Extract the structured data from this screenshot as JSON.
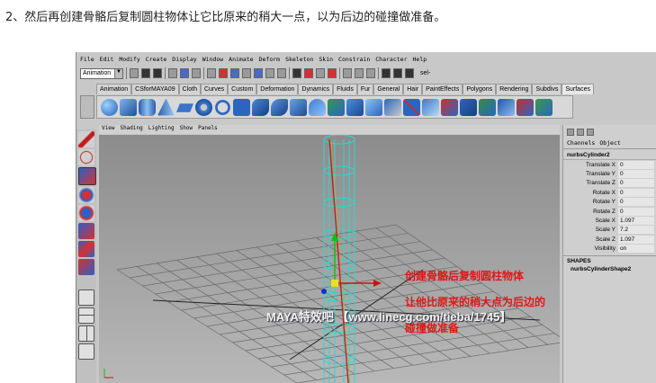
{
  "caption": "2、然后再创建骨骼后复制圆柱物体让它比原来的稍大一点，以为后边的碰撞做准备。",
  "menubar": [
    "File",
    "Edit",
    "Modify",
    "Create",
    "Display",
    "Window",
    "Animate",
    "Deform",
    "Skeleton",
    "Skin",
    "Constrain",
    "Character",
    "Help"
  ],
  "statusline": {
    "mode": "Animation",
    "sel_label": "sel-"
  },
  "shelf_tabs": [
    "Animation",
    "CSforMAYA09",
    "Cloth",
    "Curves",
    "Custom",
    "Deformation",
    "Dynamics",
    "Fluids",
    "Fur",
    "General",
    "Hair",
    "PaintEffects",
    "Polygons",
    "Rendering",
    "Subdivs",
    "Surfaces"
  ],
  "shelf_active": "Surfaces",
  "panel_menu": [
    "View",
    "Shading",
    "Lighting",
    "Show",
    "Panels"
  ],
  "channel_box": {
    "menu": [
      "Channels",
      "Object"
    ],
    "node": "nurbsCylinder2",
    "attrs": [
      {
        "name": "Translate X",
        "value": "0"
      },
      {
        "name": "Translate Y",
        "value": "0"
      },
      {
        "name": "Translate Z",
        "value": "0"
      },
      {
        "name": "Rotate X",
        "value": "0"
      },
      {
        "name": "Rotate Y",
        "value": "0"
      },
      {
        "name": "Rotate Z",
        "value": "0"
      },
      {
        "name": "Scale X",
        "value": "1.097"
      },
      {
        "name": "Scale Y",
        "value": "7.2"
      },
      {
        "name": "Scale Z",
        "value": "1.097"
      },
      {
        "name": "Visibility",
        "value": "on"
      }
    ],
    "shapes_label": "SHAPES",
    "shape_name": "nurbsCylinderShape2"
  },
  "viewport_caption": [
    "创建骨骼后复制圆柱物体",
    "让他比原来的稍大点为后边的",
    "碰撞做准备"
  ],
  "watermark": "MAYA特效吧 【www.linecg.com/tieba/1745】",
  "colors": {
    "caption_red": "#e01818",
    "wire_cyan": "#2fd6cf",
    "joint_red": "#c02020"
  }
}
